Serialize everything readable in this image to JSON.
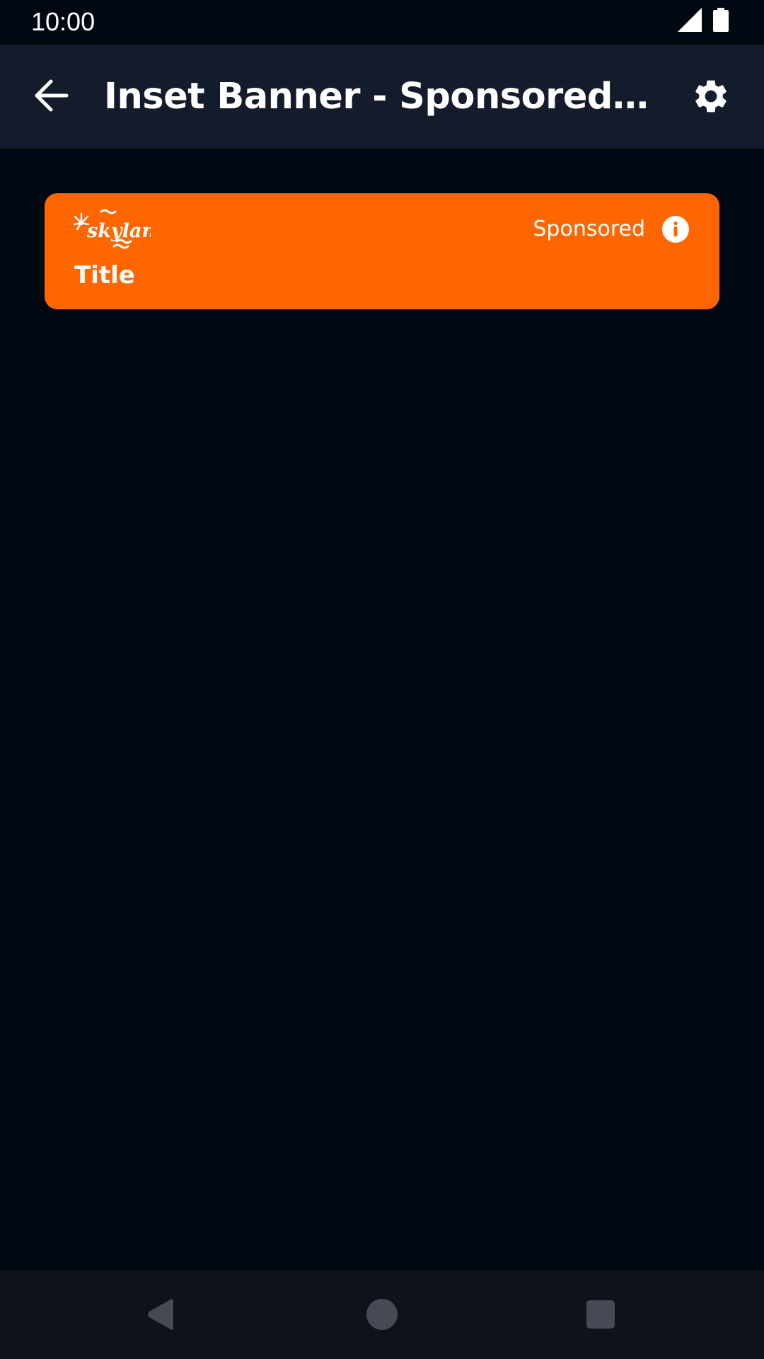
{
  "status_bar": {
    "time": "10:00",
    "icons": [
      "cell-signal-icon",
      "battery-icon"
    ]
  },
  "app_bar": {
    "title": "Inset Banner - Sponsored OnD...",
    "back_icon": "arrow-back-icon",
    "settings_icon": "gear-icon"
  },
  "banner": {
    "logo_text": "skyland",
    "title": "Title",
    "sponsored_label": "Sponsored",
    "info_icon": "info-icon",
    "background_color": "#ff6600"
  },
  "nav_bar": {
    "icons": [
      "nav-back-icon",
      "nav-home-icon",
      "nav-recents-icon"
    ]
  },
  "colors": {
    "background": "#020812",
    "app_bar": "#141c2b",
    "nav_bar": "#0e121b",
    "accent": "#ff6600"
  }
}
